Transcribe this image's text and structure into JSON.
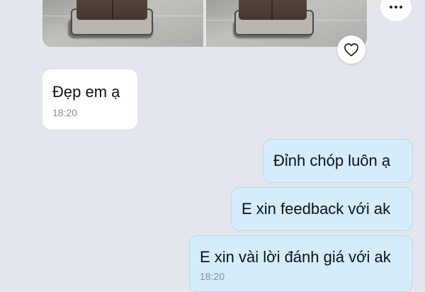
{
  "conversation": {
    "photos": [
      {
        "label": "photo-1"
      },
      {
        "label": "photo-2"
      }
    ],
    "reaction_icon": "heart-icon",
    "more_icon": "more-icon",
    "messages": [
      {
        "direction": "incoming",
        "text": "Đẹp em ạ",
        "time": "18:20"
      },
      {
        "direction": "outgoing",
        "text": "Đỉnh chóp luôn ạ"
      },
      {
        "direction": "outgoing",
        "text": "E xin feedback với ak"
      },
      {
        "direction": "outgoing",
        "text": "E xin vài lời đánh giá với ak",
        "time": "18:20"
      }
    ]
  },
  "colors": {
    "background": "#e3e7ed",
    "incoming_bubble": "#ffffff",
    "outgoing_bubble": "#d4ecfb",
    "timestamp": "#8a8f96"
  }
}
